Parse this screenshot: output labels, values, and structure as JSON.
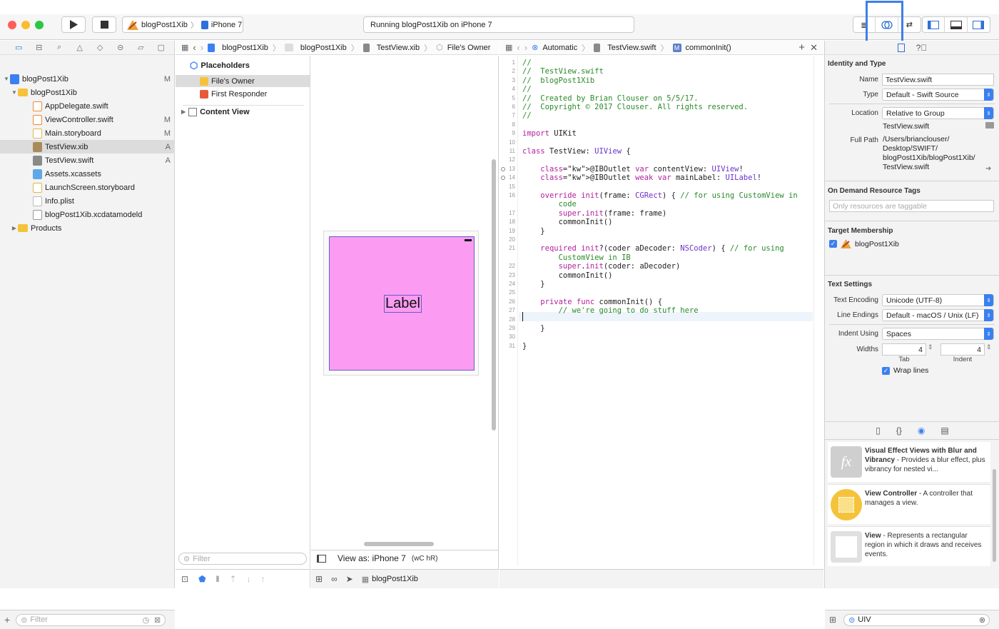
{
  "toolbar": {
    "scheme_target": "blogPost1Xib",
    "scheme_device": "iPhone 7",
    "status_text": "Running blogPost1Xib on iPhone 7"
  },
  "navigator": {
    "items": [
      {
        "label": "blogPost1Xib",
        "badge": "M"
      },
      {
        "label": "blogPost1Xib",
        "badge": ""
      },
      {
        "label": "AppDelegate.swift",
        "badge": ""
      },
      {
        "label": "ViewController.swift",
        "badge": "M"
      },
      {
        "label": "Main.storyboard",
        "badge": "M"
      },
      {
        "label": "TestView.xib",
        "badge": "A"
      },
      {
        "label": "TestView.swift",
        "badge": "A"
      },
      {
        "label": "Assets.xcassets",
        "badge": ""
      },
      {
        "label": "LaunchScreen.storyboard",
        "badge": ""
      },
      {
        "label": "Info.plist",
        "badge": ""
      },
      {
        "label": "blogPost1Xib.xcdatamodeld",
        "badge": ""
      },
      {
        "label": "Products",
        "badge": ""
      }
    ],
    "filter_placeholder": "Filter"
  },
  "ib_jumpbar": [
    "blogPost1Xib",
    "blogPost1Xib",
    "TestView.xib",
    "File's Owner"
  ],
  "outline": {
    "placeholders_header": "Placeholders",
    "files_owner": "File's Owner",
    "first_responder": "First Responder",
    "content_view": "Content View",
    "filter_placeholder": "Filter"
  },
  "canvas": {
    "label_text": "Label",
    "view_as": "View as: iPhone 7",
    "size_class": "(wC hR)",
    "view_color": "#fb9cf2"
  },
  "editor_jumpbar": [
    "Automatic",
    "TestView.swift",
    "commonInit()"
  ],
  "code": {
    "lines": [
      {
        "n": "1",
        "t": "//"
      },
      {
        "n": "2",
        "t": "//  TestView.swift"
      },
      {
        "n": "3",
        "t": "//  blogPost1Xib"
      },
      {
        "n": "4",
        "t": "//"
      },
      {
        "n": "5",
        "t": "//  Created by Brian Clouser on 5/5/17."
      },
      {
        "n": "6",
        "t": "//  Copyright © 2017 Clouser. All rights reserved."
      },
      {
        "n": "7",
        "t": "//"
      },
      {
        "n": "8",
        "t": ""
      },
      {
        "n": "9",
        "t": "import UIKit"
      },
      {
        "n": "10",
        "t": ""
      },
      {
        "n": "11",
        "t": "class TestView: UIView {"
      },
      {
        "n": "12",
        "t": ""
      },
      {
        "n": "13",
        "t": "    @IBOutlet var contentView: UIView!"
      },
      {
        "n": "14",
        "t": "    @IBOutlet weak var mainLabel: UILabel!"
      },
      {
        "n": "15",
        "t": ""
      },
      {
        "n": "16",
        "t": "    override init(frame: CGRect) { // for using CustomView in"
      },
      {
        "n": "",
        "t": "        code"
      },
      {
        "n": "17",
        "t": "        super.init(frame: frame)"
      },
      {
        "n": "18",
        "t": "        commonInit()"
      },
      {
        "n": "19",
        "t": "    }"
      },
      {
        "n": "20",
        "t": ""
      },
      {
        "n": "21",
        "t": "    required init?(coder aDecoder: NSCoder) { // for using"
      },
      {
        "n": "",
        "t": "        CustomView in IB"
      },
      {
        "n": "22",
        "t": "        super.init(coder: aDecoder)"
      },
      {
        "n": "23",
        "t": "        commonInit()"
      },
      {
        "n": "24",
        "t": "    }"
      },
      {
        "n": "25",
        "t": ""
      },
      {
        "n": "26",
        "t": "    private func commonInit() {"
      },
      {
        "n": "27",
        "t": "        // we're going to do stuff here"
      },
      {
        "n": "28",
        "t": ""
      },
      {
        "n": "29",
        "t": "    }"
      },
      {
        "n": "30",
        "t": ""
      },
      {
        "n": "31",
        "t": "}"
      }
    ]
  },
  "inspector": {
    "identity_header": "Identity and Type",
    "name_label": "Name",
    "name_value": "TestView.swift",
    "type_label": "Type",
    "type_value": "Default - Swift Source",
    "location_label": "Location",
    "location_value": "Relative to Group",
    "location_file": "TestView.swift",
    "fullpath_label": "Full Path",
    "fullpath_lines": [
      "/Users/brianclouser/",
      "Desktop/SWIFT/",
      "blogPost1Xib/blogPost1Xib/",
      "TestView.swift"
    ],
    "ondemand_header": "On Demand Resource Tags",
    "ondemand_placeholder": "Only resources are taggable",
    "target_header": "Target Membership",
    "target_name": "blogPost1Xib",
    "text_settings_header": "Text Settings",
    "encoding_label": "Text Encoding",
    "encoding_value": "Unicode (UTF-8)",
    "lineendings_label": "Line Endings",
    "lineendings_value": "Default - macOS / Unix (LF)",
    "indent_label": "Indent Using",
    "indent_value": "Spaces",
    "widths_label": "Widths",
    "tab_value": "4",
    "tab_label": "Tab",
    "indent_width_value": "4",
    "indent_width_label": "Indent",
    "wrap_label": "Wrap lines"
  },
  "library": {
    "items": [
      {
        "title": "Visual Effect Views with Blur and Vibrancy",
        "desc": " - Provides a blur effect, plus vibrancy for nested vi..."
      },
      {
        "title": "View Controller",
        "desc": " - A controller that manages a view."
      },
      {
        "title": "View",
        "desc": " - Represents a rectangular region in which it draws and receives events."
      }
    ],
    "search_value": "UIV"
  },
  "debugbar": {
    "target": "blogPost1Xib"
  },
  "colors": {
    "accent": "#3b80f0",
    "highlight_box": "#3f7ee6"
  }
}
